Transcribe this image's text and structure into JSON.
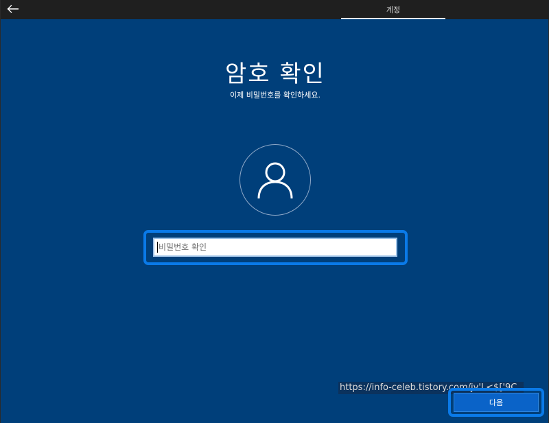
{
  "topbar": {
    "back_icon": "arrow-left-icon",
    "tab_label": "계정"
  },
  "main": {
    "title": "암호 확인",
    "subtitle": "이제 비밀번호를 확인하세요.",
    "avatar_icon": "user-icon",
    "password_placeholder": "비밀번호 확인",
    "password_value": ""
  },
  "watermark": {
    "text": "https://info-celeb.tistory.com/jv'L<$['9C"
  },
  "footer": {
    "next_label": "다음"
  },
  "colors": {
    "background": "#003f7a",
    "topbar": "#1f1f1f",
    "highlight": "#0a7ae8",
    "button": "#0a63c8"
  }
}
